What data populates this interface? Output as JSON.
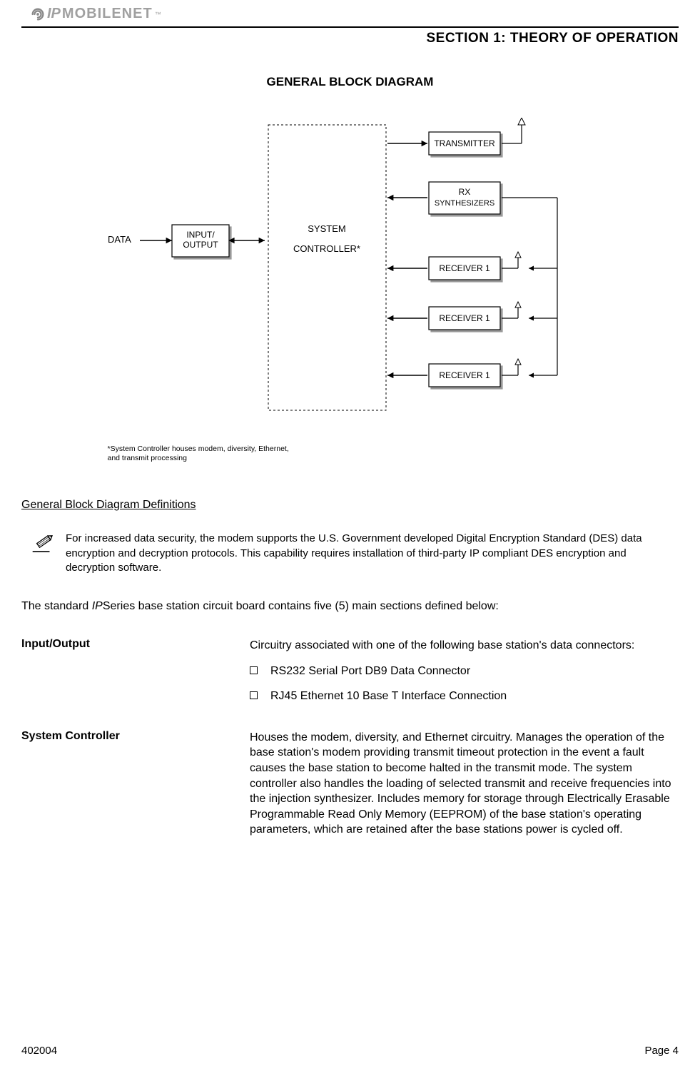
{
  "header": {
    "logo_ip": "IP",
    "logo_mobilenet": "MOBILENET",
    "section_title": "SECTION 1:  THEORY OF OPERATION"
  },
  "diagram": {
    "title": "GENERAL BLOCK DIAGRAM",
    "data_label": "DATA",
    "input_output": "INPUT/\nOUTPUT",
    "system_controller": "SYSTEM\nCONTROLLER*",
    "transmitter": "TRANSMITTER",
    "rx_synth": "RX\nSYNTHESIZERS",
    "receiver1": "RECEIVER 1",
    "receiver2": "RECEIVER 1",
    "receiver3": "RECEIVER 1",
    "note": "*System Controller houses modem, diversity, Ethernet, and transmit processing"
  },
  "definitions_heading": "General Block Diagram Definitions",
  "security_note": "For increased data security, the modem supports the U.S. Government developed Digital Encryption Standard (DES) data encryption and decryption protocols.  This capability requires installation of third-party IP compliant DES encryption and decryption software.",
  "intro_prefix": "The standard ",
  "intro_italic": "IP",
  "intro_suffix": "Series base station circuit board contains five (5) main sections defined below:",
  "defs": {
    "io": {
      "term": "Input/Output",
      "desc": "Circuitry associated with one of the following base station's data connectors:",
      "bullets": [
        "RS232 Serial Port DB9 Data Connector",
        "RJ45 Ethernet 10 Base T Interface Connection"
      ]
    },
    "sysctl": {
      "term": "System Controller",
      "desc": "Houses the modem, diversity, and Ethernet circuitry.  Manages the operation of the base station's modem providing transmit timeout protection in the event a fault causes the base station to become halted in the transmit mode.  The system controller also handles the loading of selected transmit and receive frequencies into the injection synthesizer.  Includes memory for storage through Electrically Erasable Programmable Read Only Memory (EEPROM) of the base station's operating parameters, which are retained after the base stations power is cycled off."
    }
  },
  "footer": {
    "left": "402004",
    "right": "Page 4"
  }
}
